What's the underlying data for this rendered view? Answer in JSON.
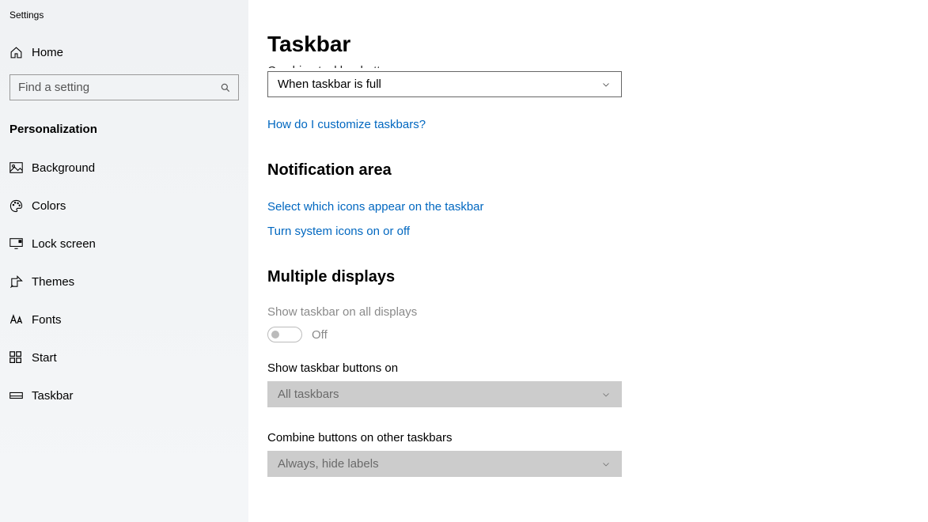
{
  "app_title": "Settings",
  "sidebar": {
    "home_label": "Home",
    "search_placeholder": "Find a setting",
    "section_label": "Personalization",
    "items": [
      {
        "label": "Background"
      },
      {
        "label": "Colors"
      },
      {
        "label": "Lock screen"
      },
      {
        "label": "Themes"
      },
      {
        "label": "Fonts"
      },
      {
        "label": "Start"
      },
      {
        "label": "Taskbar"
      }
    ]
  },
  "main": {
    "title": "Taskbar",
    "cutoff_label": "Combine taskbar buttons",
    "combine_dropdown_value": "When taskbar is full",
    "help_link": "How do I customize taskbars?",
    "notification_heading": "Notification area",
    "link_select_icons": "Select which icons appear on the taskbar",
    "link_system_icons": "Turn system icons on or off",
    "multiple_heading": "Multiple displays",
    "show_all_label": "Show taskbar on all displays",
    "show_all_state": "Off",
    "show_buttons_label": "Show taskbar buttons on",
    "show_buttons_value": "All taskbars",
    "combine_other_label": "Combine buttons on other taskbars",
    "combine_other_value": "Always, hide labels"
  }
}
